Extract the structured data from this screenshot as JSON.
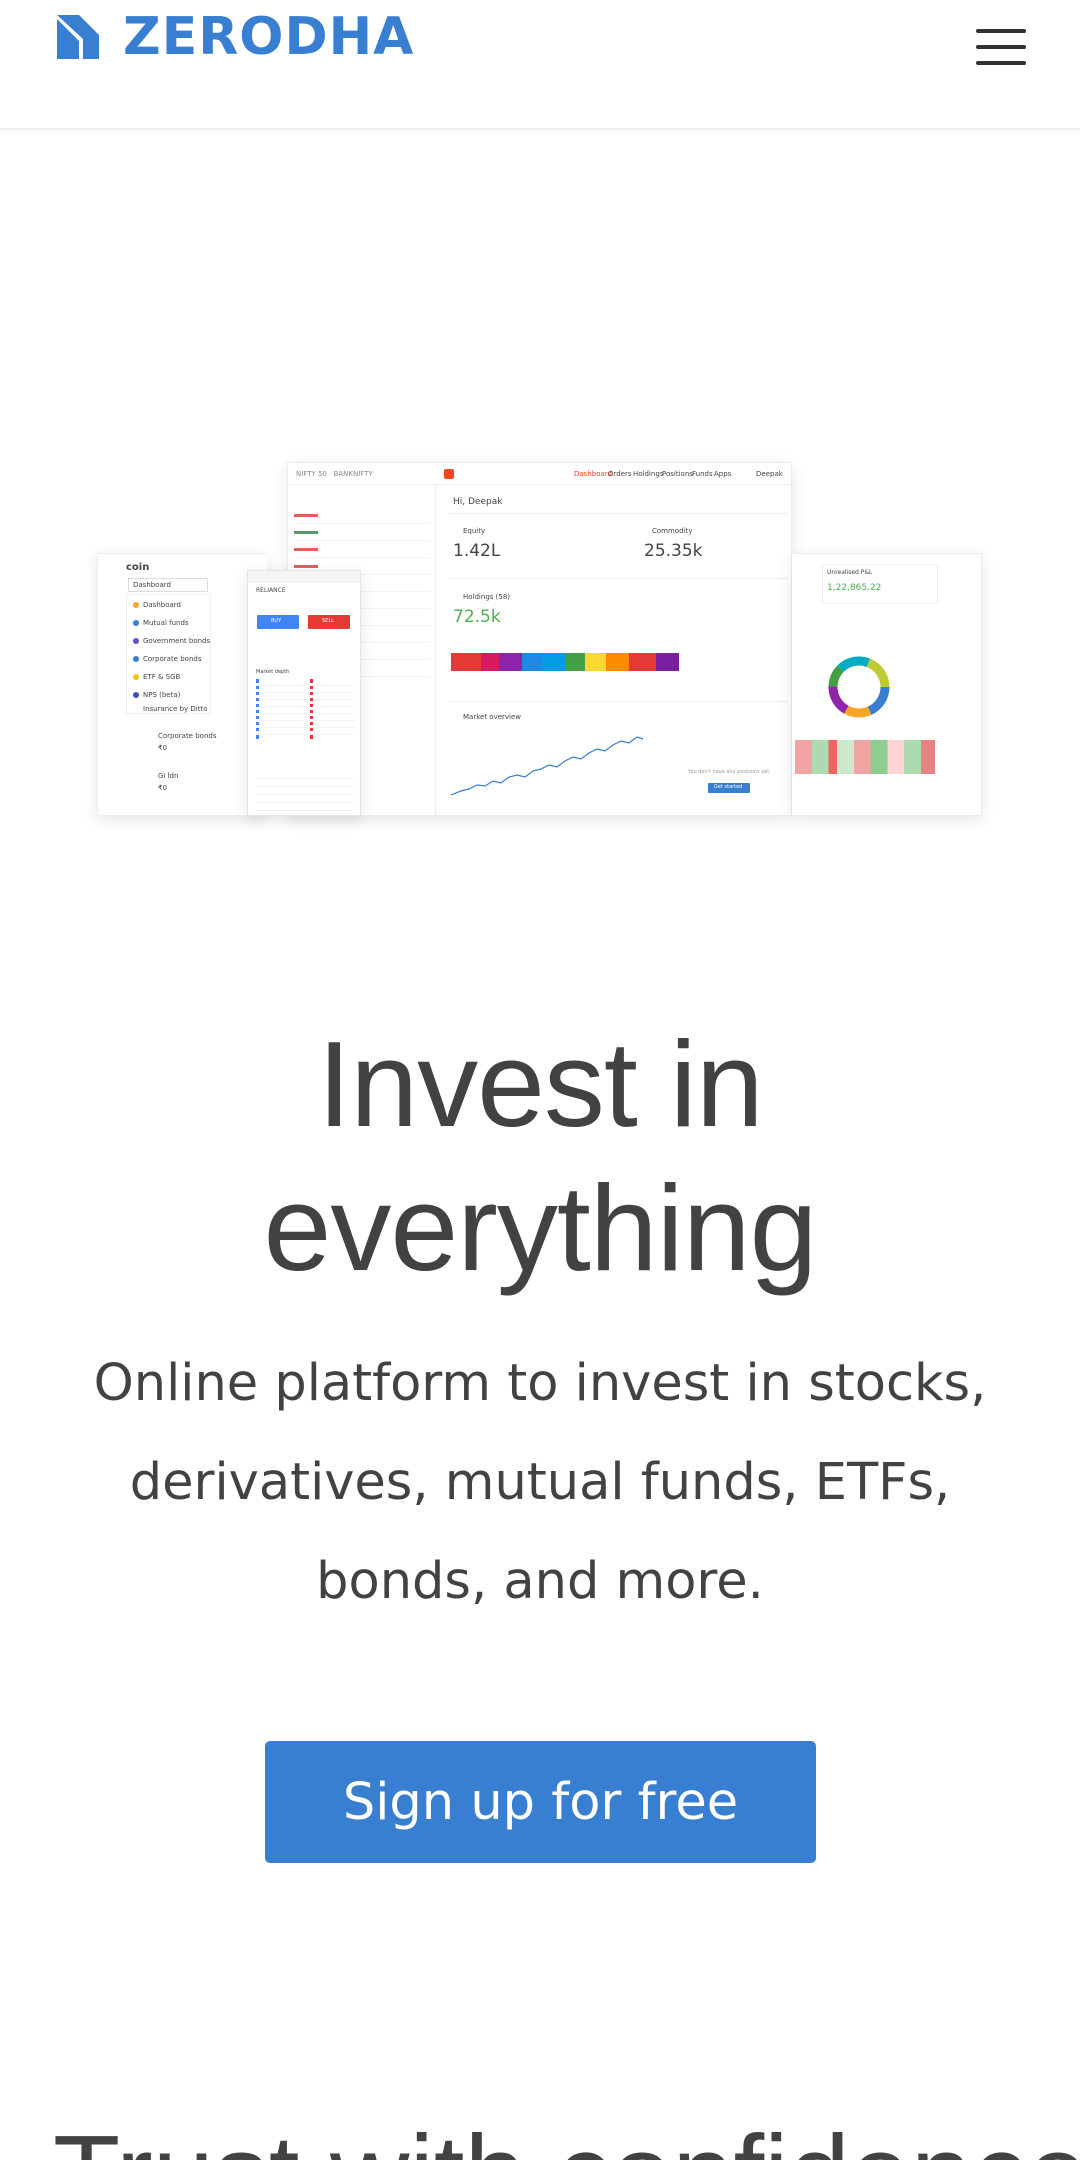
{
  "header": {
    "logo_text": "ZERODHA",
    "menu_icon": "hamburger-menu-icon"
  },
  "illustration": {
    "coin": {
      "brand": "coin",
      "dropdown": "Dashboard",
      "menu": [
        "Dashboard",
        "Mutual funds",
        "Government bonds",
        "Corporate bonds",
        "ETF & SGB",
        "NPS (beta)",
        "Insurance by Ditto"
      ],
      "rows": [
        "Corporate bonds",
        "₹0",
        "Gi ldn",
        "₹0"
      ]
    },
    "order": {
      "symbol": "RELIANCE",
      "buy": "BUY",
      "sell": "SELL",
      "depth_title": "Market depth"
    },
    "dashboard": {
      "greeting": "Hi, Deepak",
      "equity_label": "Equity",
      "equity_value": "1.42L",
      "commodity_label": "Commodity",
      "commodity_value": "25.35k",
      "holdings_label": "Holdings (58)",
      "holdings_value": "72.5k",
      "market_label": "Market overview",
      "empty_text": "You don't have any positions yet",
      "get_started": "Get started",
      "nav": [
        "Dashboard",
        "Orders",
        "Holdings",
        "Positions",
        "Funds",
        "Apps"
      ],
      "user": "Deepak"
    },
    "portfolio": {
      "label": "Unrealised P&L",
      "value": "1,22,865.22"
    }
  },
  "hero": {
    "headline_line1": "Invest in",
    "headline_line2": "everything",
    "subtext": "Online platform to invest in stocks, derivatives, mutual funds, ETFs, bonds, and more.",
    "cta_label": "Sign up for free"
  },
  "next_section": {
    "heading_partial": "Trust with confidence"
  },
  "colors": {
    "brand_blue": "#387ed1",
    "text": "#424242"
  }
}
